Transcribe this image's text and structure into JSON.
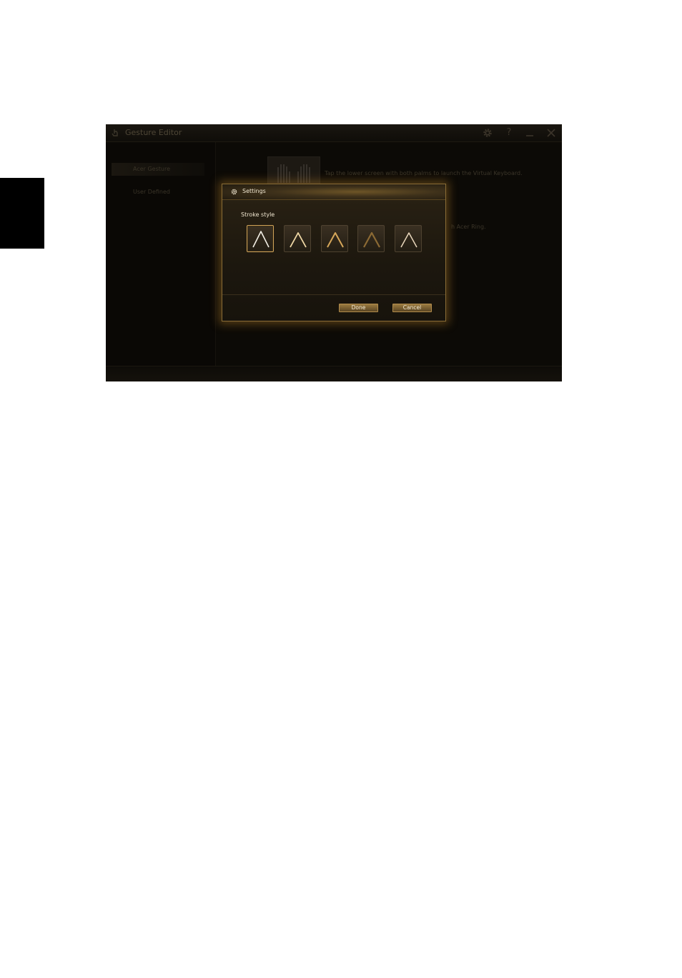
{
  "app": {
    "title": "Gesture Editor",
    "help_symbol": "?"
  },
  "sidebar": {
    "items": [
      {
        "label": "Acer Gesture",
        "active": true
      },
      {
        "label": "User Defined",
        "active": false
      }
    ]
  },
  "content": {
    "description_1": "Tap the lower screen with both palms to launch the Virtual Keyboard.",
    "description_2": "h Acer Ring."
  },
  "dialog": {
    "title": "Settings",
    "section_label": "Stroke style",
    "stroke_options": [
      {
        "id": "white",
        "selected": true,
        "color": "#f4f0e6"
      },
      {
        "id": "cream",
        "selected": false,
        "color": "#f1d9a6"
      },
      {
        "id": "gold",
        "selected": false,
        "color": "#d6a75a"
      },
      {
        "id": "bronze",
        "selected": false,
        "color": "#8c6a34"
      },
      {
        "id": "warm-white",
        "selected": false,
        "color": "#ead8bd"
      }
    ],
    "done_label": "Done",
    "cancel_label": "Cancel"
  },
  "colors": {
    "accent": "#b38d4c",
    "app_background": "#0c0a06"
  },
  "icons": [
    "hand-pointer-icon",
    "gear-icon",
    "help-icon",
    "minimize-icon",
    "close-icon",
    "settings-icon",
    "palms-icon"
  ]
}
